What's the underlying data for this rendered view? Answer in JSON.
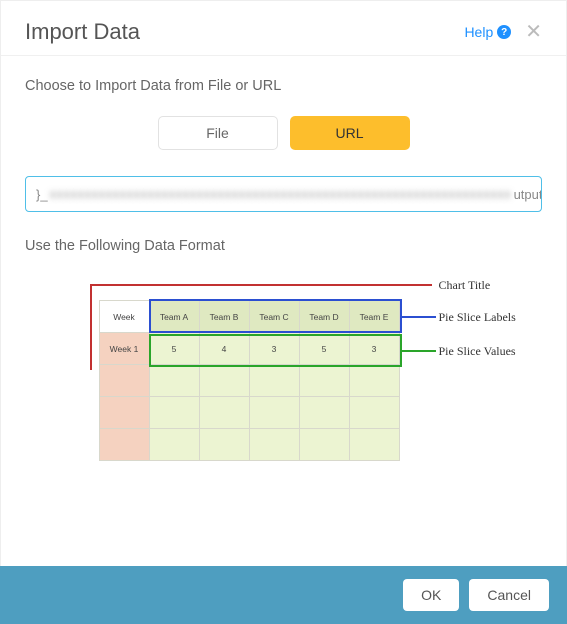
{
  "header": {
    "title": "Import Data",
    "help_label": "Help"
  },
  "body": {
    "choose_label": "Choose to Import Data from File or URL",
    "tab_file": "File",
    "tab_url": "URL",
    "url_lead": "}_",
    "url_tail": "utput=csv",
    "format_label": "Use the Following Data Format"
  },
  "diagram": {
    "corner": "Week",
    "headers": [
      "Team A",
      "Team B",
      "Team C",
      "Team D",
      "Team E"
    ],
    "row_label": "Week 1",
    "values": [
      "5",
      "4",
      "3",
      "5",
      "3"
    ],
    "anno_title": "Chart Title",
    "anno_labels": "Pie Slice Labels",
    "anno_values": "Pie Slice Values"
  },
  "footer": {
    "ok": "OK",
    "cancel": "Cancel"
  }
}
